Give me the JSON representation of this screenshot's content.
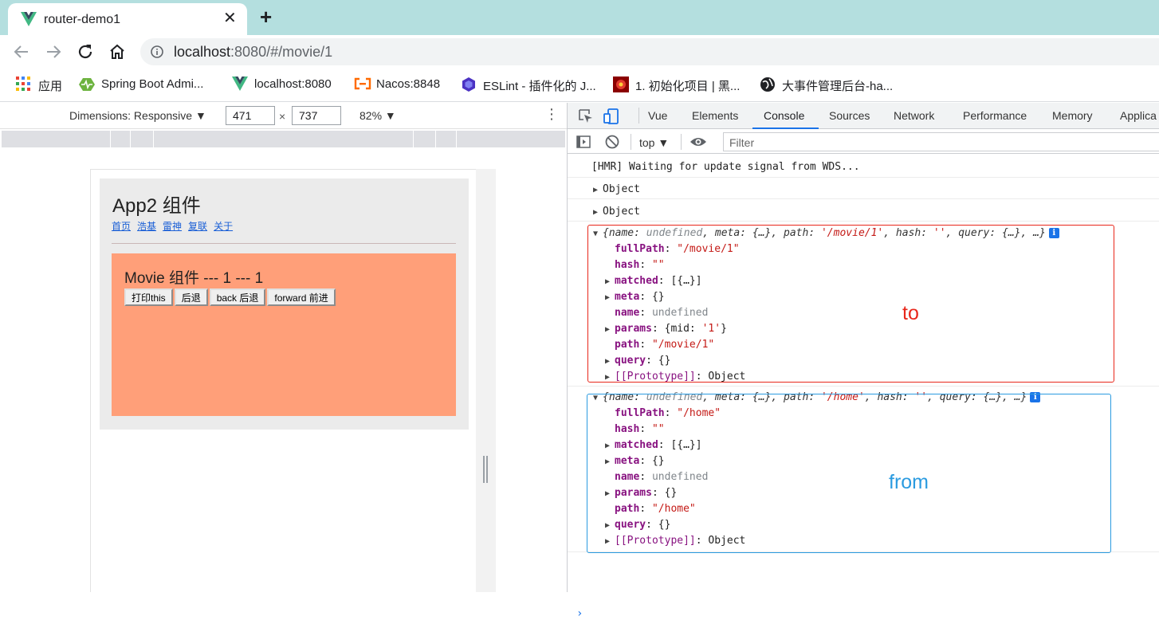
{
  "browser": {
    "tab_title": "router-demo1",
    "close_glyph": "✕",
    "new_tab_glyph": "+",
    "url_host": "localhost",
    "url_rest": ":8080/#/movie/1",
    "bookmarks": [
      {
        "label": "应用",
        "icon": "apps-grid-icon"
      },
      {
        "label": "Spring Boot Admi...",
        "icon": "spring-boot-admin-icon"
      },
      {
        "label": "localhost:8080",
        "icon": "vue-logo-icon"
      },
      {
        "label": "Nacos:8848",
        "icon": "nacos-icon"
      },
      {
        "label": "ESLint - 插件化的 J...",
        "icon": "eslint-icon"
      },
      {
        "label": "1. 初始化项目 | 黑...",
        "icon": "site-icon"
      },
      {
        "label": "大事件管理后台-ha...",
        "icon": "globe-icon"
      }
    ]
  },
  "device_toolbar": {
    "dimensions": "Dimensions: Responsive ▼",
    "width": "471",
    "height": "737",
    "times": "×",
    "zoom": "82% ▼",
    "more": "⋮"
  },
  "app": {
    "title": "App2 组件",
    "links": [
      "首页",
      "浩基",
      "雷神",
      "复联",
      "关于"
    ],
    "movie_title": "Movie 组件 --- 1 --- 1",
    "buttons": [
      "打印this",
      "后退",
      "back 后退",
      "forward 前进"
    ]
  },
  "devtools": {
    "tabs": [
      "Vue",
      "Elements",
      "Console",
      "Sources",
      "Network",
      "Performance",
      "Memory",
      "Applica"
    ],
    "active_tab": "Console",
    "context": "top ▼",
    "filter_placeholder": "Filter",
    "console": {
      "hmr": "[HMR] Waiting for update signal from WDS...",
      "object_label": "Object",
      "to_object": {
        "header_name": "name",
        "header_undefined": "undefined",
        "header_meta": "meta",
        "header_obj": "{…}",
        "header_path_key": "path",
        "header_path": "'/movie/1'",
        "header_hash_key": "hash",
        "header_hash": "''",
        "header_query_key": "query",
        "header_tail": "…}",
        "fullPath_key": "fullPath",
        "fullPath": "\"/movie/1\"",
        "hash_key": "hash",
        "hash": "\"\"",
        "matched_key": "matched",
        "matched": "[{…}]",
        "meta_key": "meta",
        "meta": "{}",
        "name_key": "name",
        "name": "undefined",
        "params_key": "params",
        "params_open": "{mid: ",
        "params_val": "'1'",
        "params_close": "}",
        "path_key": "path",
        "path": "\"/movie/1\"",
        "query_key": "query",
        "query": "{}",
        "proto_key": "[[Prototype]]",
        "proto": "Object"
      },
      "from_object": {
        "header_name": "name",
        "header_undefined": "undefined",
        "header_meta": "meta",
        "header_obj": "{…}",
        "header_path_key": "path",
        "header_path": "'/home'",
        "header_hash_key": "hash",
        "header_hash": "''",
        "header_query_key": "query",
        "header_tail": "…}",
        "fullPath_key": "fullPath",
        "fullPath": "\"/home\"",
        "hash_key": "hash",
        "hash": "\"\"",
        "matched_key": "matched",
        "matched": "[{…}]",
        "meta_key": "meta",
        "meta": "{}",
        "name_key": "name",
        "name": "undefined",
        "params_key": "params",
        "params": "{}",
        "path_key": "path",
        "path": "\"/home\"",
        "query_key": "query",
        "query": "{}",
        "proto_key": "[[Prototype]]",
        "proto": "Object"
      },
      "prompt": "›"
    },
    "annotations": {
      "to": "to",
      "from": "from",
      "to_color": "#e8271b",
      "from_color": "#2b9be0"
    }
  },
  "colors": {
    "tabstrip": "#b4dfdf",
    "movie_bg": "#ff9f79",
    "active_tab_underline": "#1a73e8"
  }
}
